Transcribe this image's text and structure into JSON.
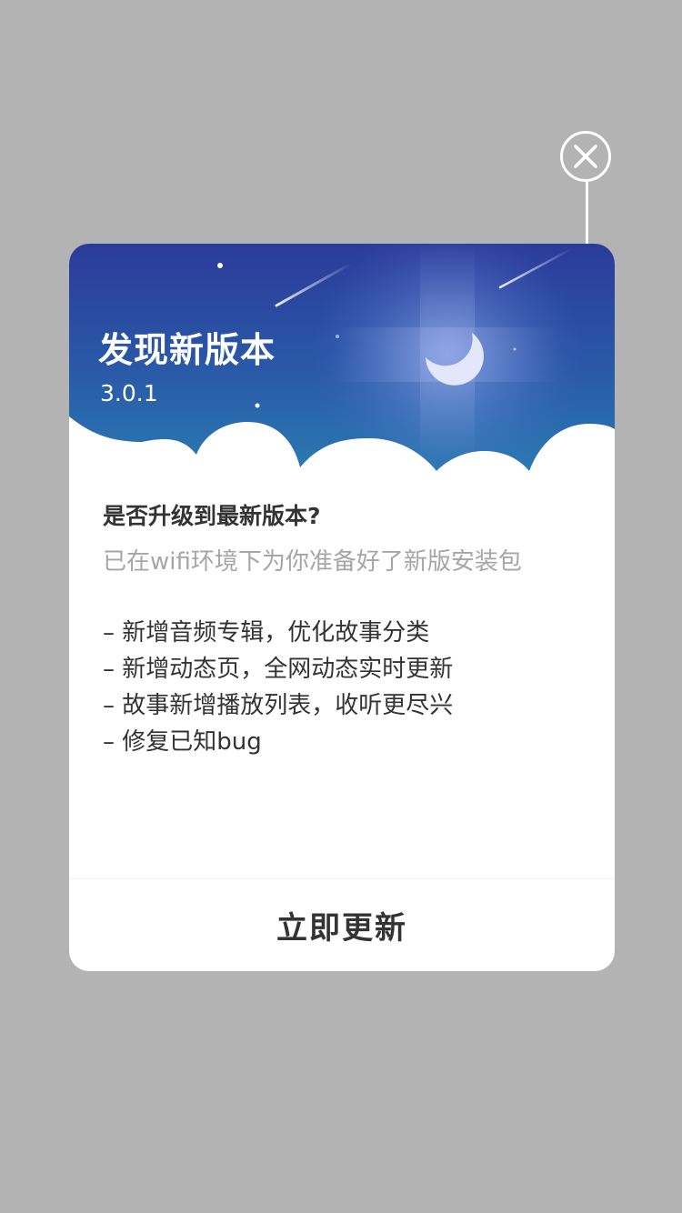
{
  "dialog": {
    "title": "发现新版本",
    "version": "3.0.1",
    "question": "是否升级到最新版本?",
    "subtitle": "已在wifi环境下为你准备好了新版安装包",
    "notes": [
      "– 新增音频专辑，优化故事分类",
      "– 新增动态页，全网动态实时更新",
      "– 故事新增播放列表，收听更尽兴",
      "– 修复已知bug"
    ],
    "update_label": "立即更新"
  },
  "icons": {
    "close": "close-icon",
    "moon": "moon-icon",
    "stars": "star-icon",
    "shooting_star": "shooting-star-icon",
    "clouds": "cloud-icon"
  },
  "colors": {
    "overlay": "#b3b3b3",
    "banner_top": "#2b3e9b",
    "banner_bottom": "#2b7ab0",
    "text_primary": "#333333",
    "text_secondary": "#a6a6a6"
  }
}
